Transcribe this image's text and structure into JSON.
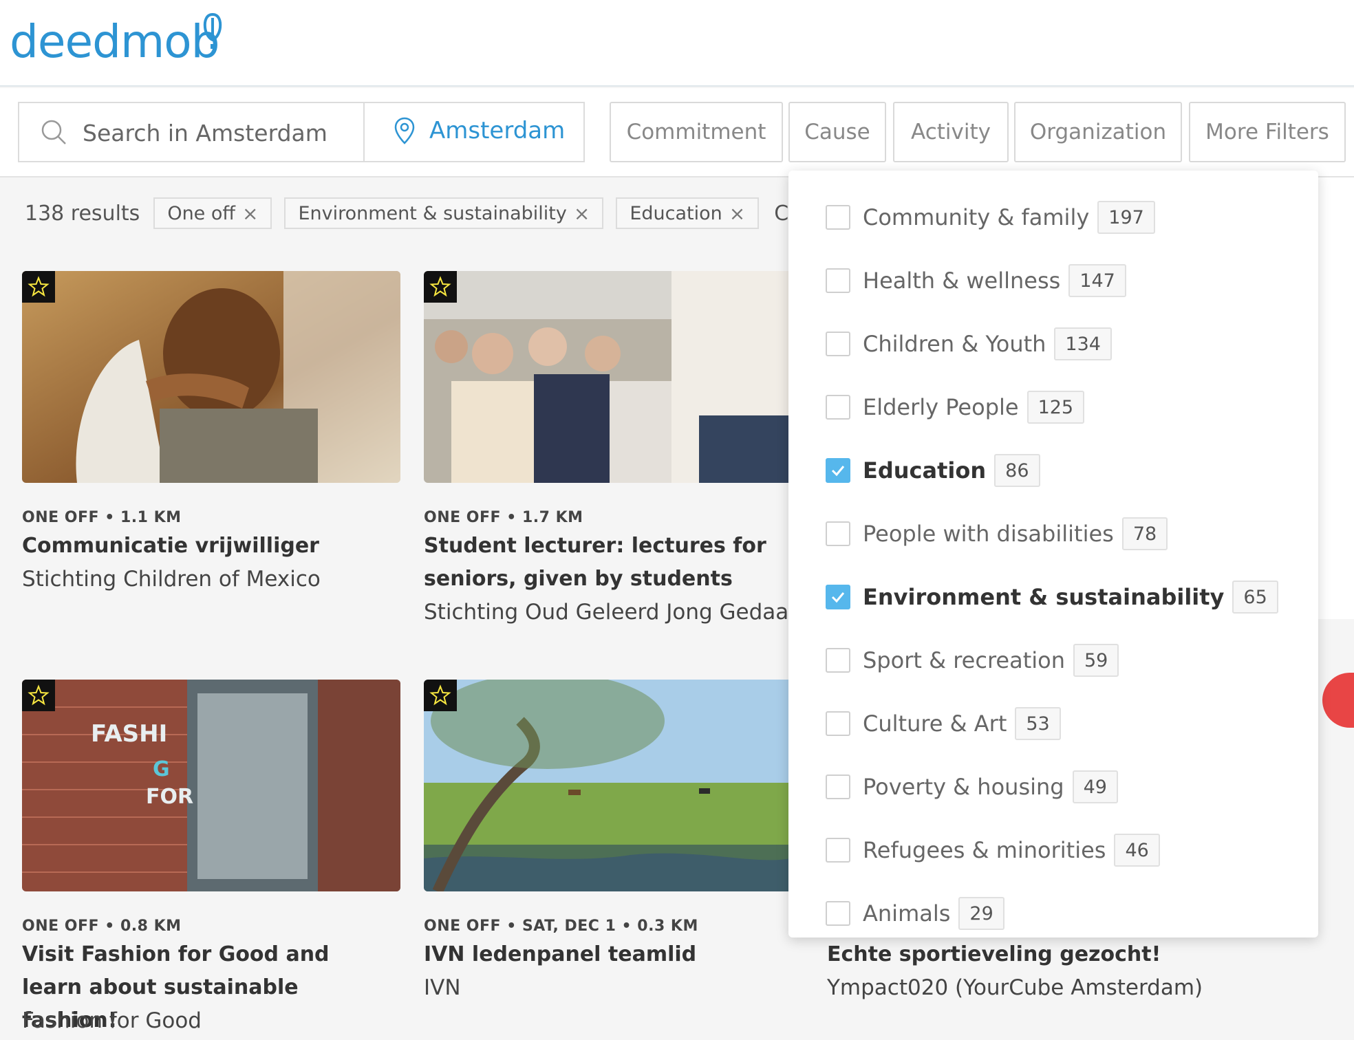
{
  "header": {
    "logo_text": "deedmob"
  },
  "search": {
    "placeholder": "Search in Amsterdam",
    "location": "Amsterdam",
    "filters": [
      "Commitment",
      "Cause",
      "Activity",
      "Organization",
      "More Filters"
    ]
  },
  "results": {
    "count_text": "138 results",
    "chips": [
      "One off",
      "Environment & sustainability",
      "Education"
    ],
    "chip_remove_glyph": "×",
    "clear_label": "Clear"
  },
  "cards": [
    {
      "meta": "ONE OFF • 1.1 KM",
      "title": "Communicatie vrijwilliger",
      "org": "Stichting Children of Mexico"
    },
    {
      "meta": "ONE OFF • 1.7 KM",
      "title": "Student lecturer: lectures for seniors, given by students",
      "org": "Stichting Oud Geleerd Jong Gedaan"
    },
    {
      "meta": "ONE OFF • 0.8 KM",
      "title": "Visit Fashion for Good and learn about sustainable fashion!",
      "org": "Fashion for Good"
    },
    {
      "meta": "ONE OFF • SAT, DEC 1 • 0.3 KM",
      "title": "IVN ledenpanel teamlid",
      "org": "IVN"
    },
    {
      "meta": "",
      "title": "Echte sportieveling gezocht!",
      "org": "Ympact020 (YourCube Amsterdam)"
    }
  ],
  "cause_dropdown": {
    "options": [
      {
        "label": "Community & family",
        "count": "197",
        "checked": false
      },
      {
        "label": "Health & wellness",
        "count": "147",
        "checked": false
      },
      {
        "label": "Children & Youth",
        "count": "134",
        "checked": false
      },
      {
        "label": "Elderly People",
        "count": "125",
        "checked": false
      },
      {
        "label": "Education",
        "count": "86",
        "checked": true
      },
      {
        "label": "People with disabilities",
        "count": "78",
        "checked": false
      },
      {
        "label": "Environment & sustainability",
        "count": "65",
        "checked": true
      },
      {
        "label": "Sport & recreation",
        "count": "59",
        "checked": false
      },
      {
        "label": "Culture & Art",
        "count": "53",
        "checked": false
      },
      {
        "label": "Poverty & housing",
        "count": "49",
        "checked": false
      },
      {
        "label": "Refugees & minorities",
        "count": "46",
        "checked": false
      },
      {
        "label": "Animals",
        "count": "29",
        "checked": false
      }
    ]
  },
  "colors": {
    "brand": "#2d94d3",
    "checkbox_checked": "#56b7ec",
    "fab": "#e84545"
  }
}
